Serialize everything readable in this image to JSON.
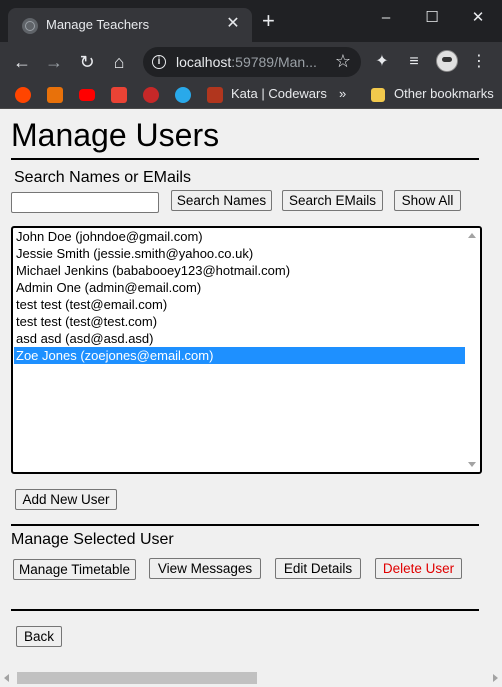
{
  "browser": {
    "tab_title": "Manage Teachers",
    "tab_close": "✕",
    "new_tab": "+",
    "url_host": "localhost",
    "url_rest": ":59789/Man...",
    "bookmarks": [
      {
        "label": "Kata | Codewars"
      }
    ],
    "bookmarks_overflow": "»",
    "other_bookmarks": "Other bookmarks",
    "window_controls": {
      "minimize": "–",
      "maximize": "☐",
      "close": "✕"
    }
  },
  "page": {
    "title": "Manage Users",
    "search_label": "Search Names or EMails",
    "search_input": {
      "value": "",
      "placeholder": ""
    },
    "buttons": {
      "search_names": "Search Names",
      "search_emails": "Search EMails",
      "show_all": "Show All",
      "add_new_user": "Add New User",
      "manage_timetable": "Manage Timetable",
      "view_messages": "View Messages",
      "edit_details": "Edit Details",
      "delete_user": "Delete User",
      "back": "Back"
    },
    "users": [
      "John Doe (johndoe@gmail.com)",
      "Jessie Smith (jessie.smith@yahoo.co.uk)",
      "Michael Jenkins (bababooey123@hotmail.com)",
      "Admin One (admin@email.com)",
      "test test (test@email.com)",
      "test test (test@test.com)",
      "asd asd (asd@asd.asd)",
      "Zoe Jones (zoejones@email.com)"
    ],
    "selected_user_index": 7,
    "manage_selected_label": "Manage Selected User"
  },
  "colors": {
    "selection": "#1e90ff",
    "danger": "#e00000",
    "chrome_dark": "#202124",
    "chrome_toolbar": "#35363a"
  }
}
